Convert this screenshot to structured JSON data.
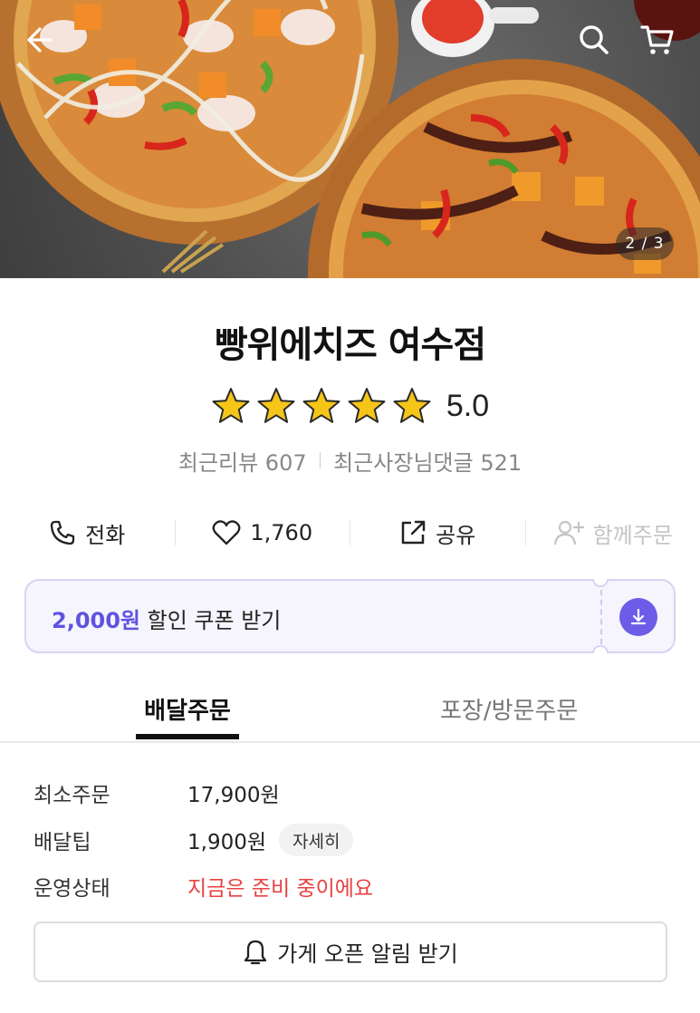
{
  "hero": {
    "page_indicator": "2 / 3",
    "icons": [
      "back-arrow-icon",
      "search-icon",
      "cart-icon"
    ]
  },
  "store": {
    "name": "빵위에치즈 여수점",
    "rating": "5.0",
    "star_count": 5,
    "recent_reviews": "최근리뷰 607",
    "recent_owner_replies": "최근사장님댓글 521"
  },
  "actions": {
    "call_label": "전화",
    "like_count": "1,760",
    "share_label": "공유",
    "group_order_label": "함께주문"
  },
  "coupon": {
    "amount": "2,000원",
    "text": " 할인 쿠폰 받기"
  },
  "tabs": [
    {
      "label": "배달주문",
      "active": true
    },
    {
      "label": "포장/방문주문",
      "active": false
    }
  ],
  "info": {
    "min_order_label": "최소주문",
    "min_order_value": "17,900원",
    "delivery_tip_label": "배달팁",
    "delivery_tip_value": "1,900원",
    "detail_label": "자세히",
    "status_label": "운영상태",
    "status_value": "지금은 준비 중이에요"
  },
  "notify_button": "가게 오픈 알림 받기",
  "colors": {
    "accent": "#6c5ce7",
    "status_red": "#e84141",
    "star": "#f5c518"
  }
}
